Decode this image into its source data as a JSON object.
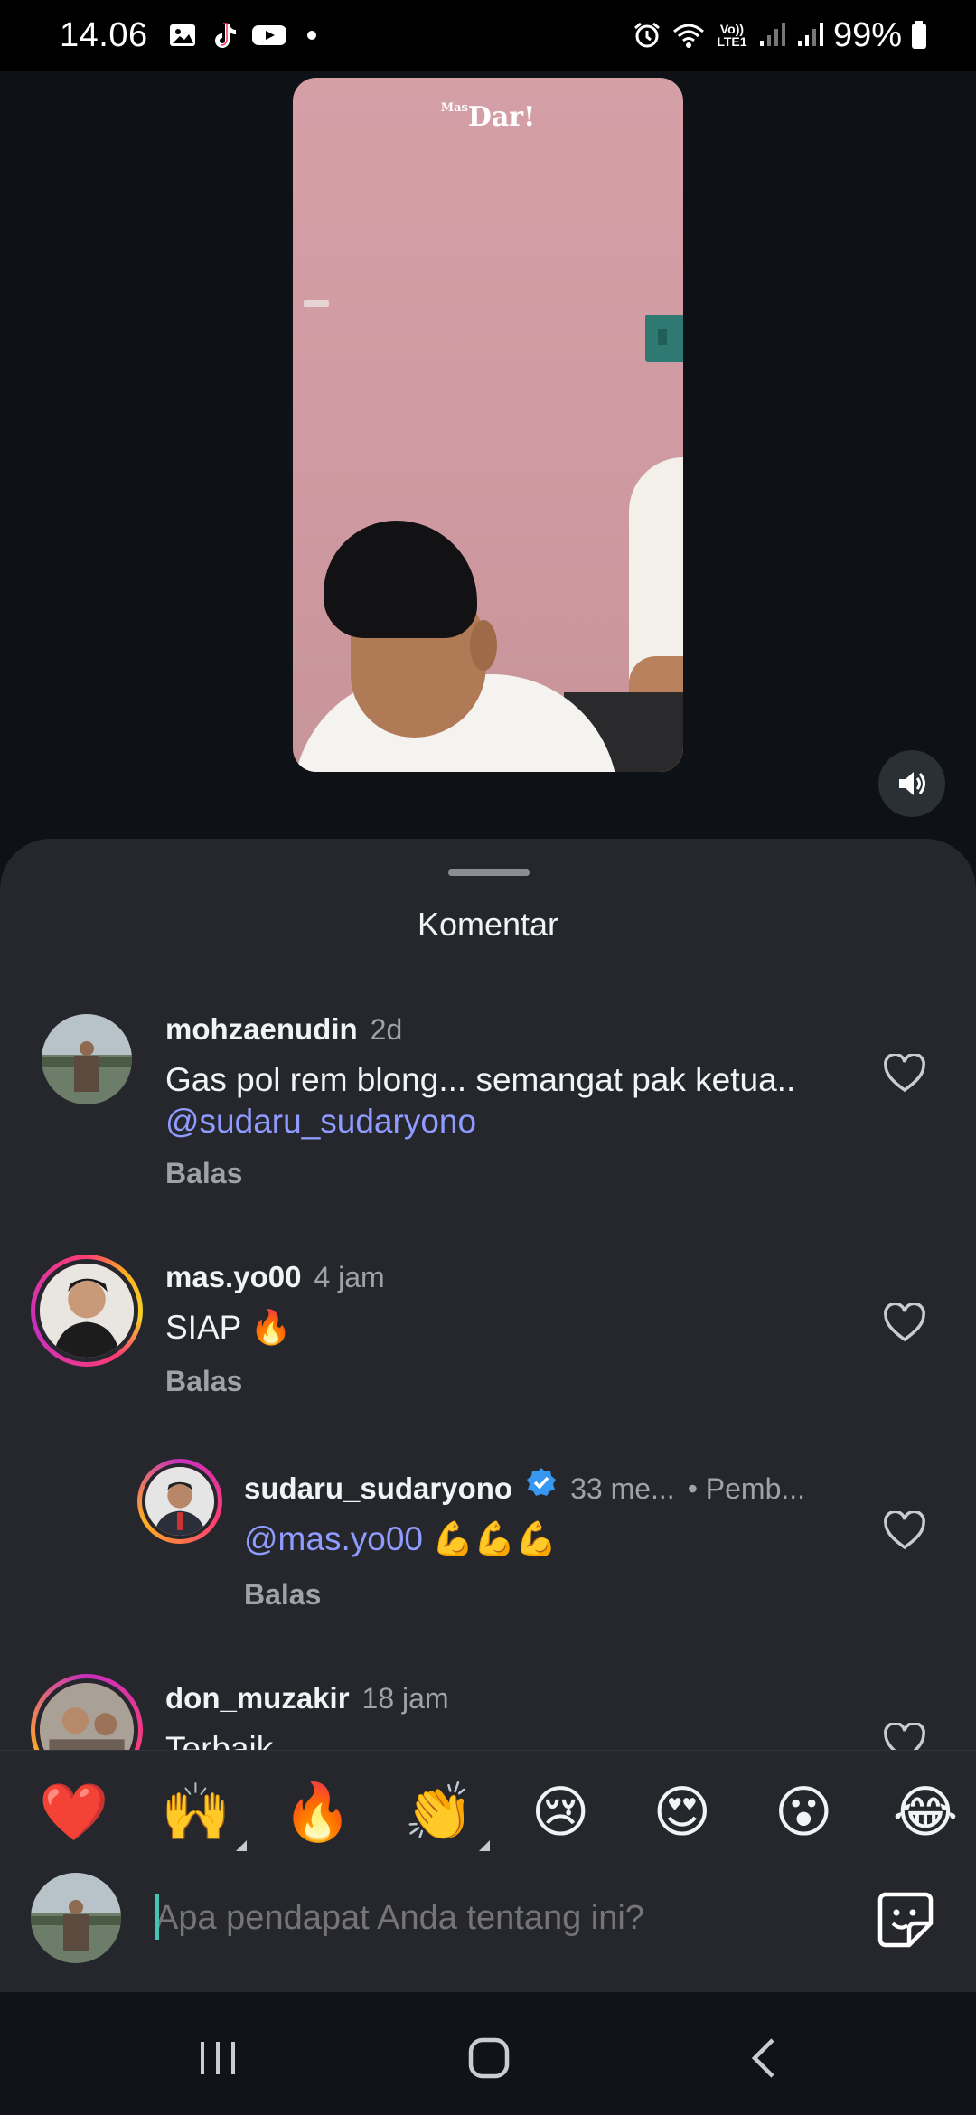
{
  "status_bar": {
    "time": "14.06",
    "battery": "99%",
    "icons_left": [
      "gallery-icon",
      "tiktok-icon",
      "youtube-icon",
      "dot-icon"
    ],
    "icons_right": [
      "alarm-icon",
      "wifi-icon",
      "volte-icon",
      "signal-icon",
      "signal-icon",
      "battery-icon"
    ],
    "volte_label": "Vo))\nLTE1"
  },
  "video": {
    "logo": "Dar!",
    "logo_prefix": "Mas",
    "sound_icon": "speaker-icon"
  },
  "sheet": {
    "title": "Komentar"
  },
  "comments": [
    {
      "user": "mohzaenudin",
      "time": "2d",
      "text": "Gas pol rem blong... semangat pak ketua..",
      "mention": "@sudaru_sudaryono",
      "reply": "Balas"
    },
    {
      "user": "mas.yo00",
      "time": "4 jam",
      "text": "SIAP 🔥",
      "reply": "Balas"
    },
    {
      "user": "sudaru_sudaryono",
      "time": "33 me...",
      "badge": "• Pemb...",
      "mention": "@mas.yo00",
      "text": "💪💪💪",
      "reply": "Balas"
    },
    {
      "user": "don_muzakir",
      "time": "18 jam",
      "text": "Terbaik"
    }
  ],
  "emoji_bar": [
    "❤️",
    "🙌",
    "🔥",
    "👏",
    "😢",
    "😍",
    "😮",
    "😂"
  ],
  "input": {
    "placeholder": "Apa pendapat Anda tentang ini?"
  },
  "colors": {
    "accent_link": "#8f9bff",
    "sheet_bg": "#25272d",
    "caret": "#46c5b5",
    "verified": "#3897f0"
  }
}
